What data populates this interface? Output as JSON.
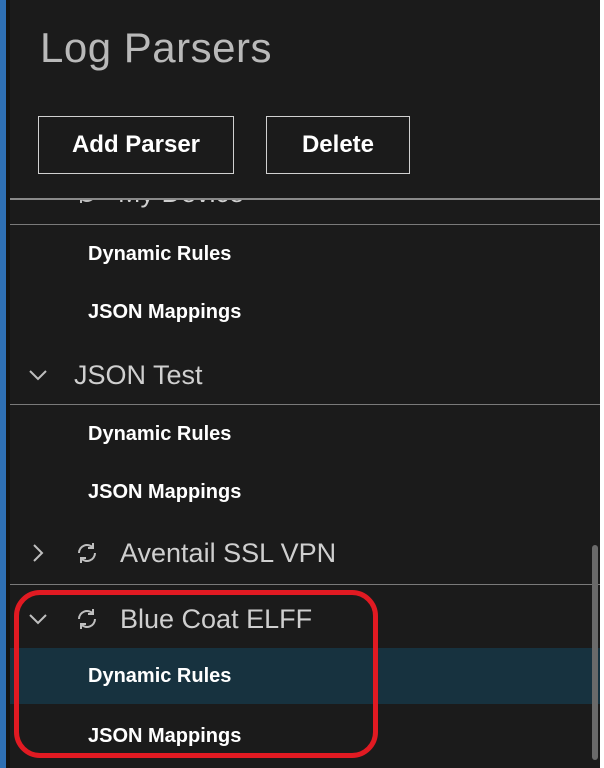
{
  "panel": {
    "title": "Log Parsers",
    "add_button_label": "Add Parser",
    "delete_button_label": "Delete"
  },
  "tree": {
    "partial_group_label": "My Device",
    "groups": [
      {
        "name": "JSON Test",
        "expanded": true,
        "children": [
          "Dynamic Rules",
          "JSON Mappings"
        ]
      },
      {
        "name": "Aventail SSL VPN",
        "expanded": false,
        "children": []
      },
      {
        "name": "Blue Coat ELFF",
        "expanded": true,
        "children": [
          "Dynamic Rules",
          "JSON Mappings"
        ],
        "selected_child": "Dynamic Rules"
      }
    ],
    "first_children": [
      "Dynamic Rules",
      "JSON Mappings"
    ]
  },
  "icons": {
    "expanded": "chevron-down-icon",
    "collapsed": "chevron-right-icon",
    "sync": "sync-icon"
  },
  "colors": {
    "background": "#1b1b1b",
    "selected_row": "#17323f",
    "highlight": "#e11a22",
    "accent_edge": "#2e6fb3"
  }
}
